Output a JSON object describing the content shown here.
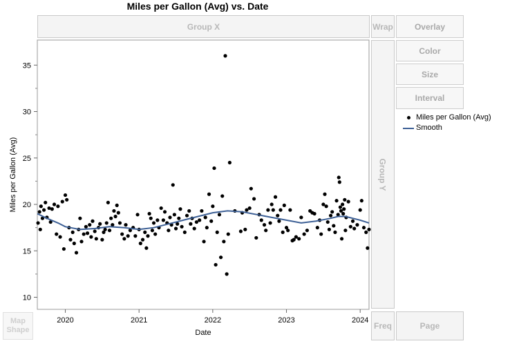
{
  "zones": {
    "group_x": "Group X",
    "group_y": "Group Y",
    "wrap": "Wrap",
    "freq": "Freq",
    "page": "Page",
    "map_shape": "Map Shape"
  },
  "buttons": {
    "overlay": "Overlay",
    "color": "Color",
    "size": "Size",
    "interval": "Interval"
  },
  "chart_data": {
    "type": "scatter",
    "title": "Miles per Gallon (Avg) vs. Date",
    "xlabel": "Date",
    "ylabel": "Miles per Gallon (Avg)",
    "xlim": [
      2019.62,
      2024.12
    ],
    "ylim": [
      8.7,
      37.7
    ],
    "x_ticks": [
      2020,
      2021,
      2022,
      2023,
      2024
    ],
    "y_ticks": [
      10,
      15,
      20,
      25,
      30,
      35
    ],
    "grid": false,
    "legend_position": "right",
    "legend": [
      "Miles per Gallon (Avg)",
      "Smooth"
    ],
    "colors": {
      "points": "#000000",
      "smooth": "#3c5f95"
    },
    "series": [
      {
        "name": "Miles per Gallon (Avg)",
        "kind": "points",
        "points": [
          [
            2019.63,
            18.0
          ],
          [
            2019.65,
            19.2
          ],
          [
            2019.66,
            17.3
          ],
          [
            2019.67,
            19.8
          ],
          [
            2019.69,
            18.5
          ],
          [
            2019.71,
            19.4
          ],
          [
            2019.73,
            20.2
          ],
          [
            2019.75,
            18.6
          ],
          [
            2019.78,
            19.6
          ],
          [
            2019.8,
            18.1
          ],
          [
            2019.82,
            19.5
          ],
          [
            2019.85,
            20.0
          ],
          [
            2019.88,
            16.8
          ],
          [
            2019.9,
            19.8
          ],
          [
            2019.93,
            16.5
          ],
          [
            2019.96,
            20.3
          ],
          [
            2019.98,
            15.2
          ],
          [
            2020.0,
            21.0
          ],
          [
            2020.02,
            20.5
          ],
          [
            2020.05,
            17.5
          ],
          [
            2020.07,
            16.2
          ],
          [
            2020.1,
            17.0
          ],
          [
            2020.12,
            15.8
          ],
          [
            2020.15,
            14.8
          ],
          [
            2020.18,
            17.3
          ],
          [
            2020.2,
            18.5
          ],
          [
            2020.22,
            16.0
          ],
          [
            2020.25,
            16.8
          ],
          [
            2020.28,
            17.6
          ],
          [
            2020.3,
            16.9
          ],
          [
            2020.33,
            17.8
          ],
          [
            2020.35,
            16.5
          ],
          [
            2020.37,
            18.2
          ],
          [
            2020.4,
            17.1
          ],
          [
            2020.42,
            16.3
          ],
          [
            2020.45,
            17.5
          ],
          [
            2020.47,
            17.9
          ],
          [
            2020.5,
            16.2
          ],
          [
            2020.52,
            17.0
          ],
          [
            2020.54,
            17.3
          ],
          [
            2020.56,
            18.0
          ],
          [
            2020.58,
            20.2
          ],
          [
            2020.6,
            17.2
          ],
          [
            2020.62,
            18.5
          ],
          [
            2020.64,
            17.8
          ],
          [
            2020.66,
            19.3
          ],
          [
            2020.68,
            18.7
          ],
          [
            2020.7,
            19.9
          ],
          [
            2020.72,
            19.1
          ],
          [
            2020.74,
            18.0
          ],
          [
            2020.77,
            16.8
          ],
          [
            2020.8,
            16.3
          ],
          [
            2020.82,
            17.8
          ],
          [
            2020.85,
            16.6
          ],
          [
            2020.88,
            17.2
          ],
          [
            2020.92,
            17.5
          ],
          [
            2020.95,
            16.6
          ],
          [
            2020.98,
            18.9
          ],
          [
            2021.0,
            17.3
          ],
          [
            2021.02,
            15.8
          ],
          [
            2021.05,
            16.2
          ],
          [
            2021.08,
            17.0
          ],
          [
            2021.1,
            15.3
          ],
          [
            2021.12,
            16.6
          ],
          [
            2021.14,
            19.0
          ],
          [
            2021.16,
            18.5
          ],
          [
            2021.18,
            17.2
          ],
          [
            2021.2,
            18.0
          ],
          [
            2021.22,
            16.8
          ],
          [
            2021.25,
            18.3
          ],
          [
            2021.27,
            17.5
          ],
          [
            2021.3,
            19.6
          ],
          [
            2021.33,
            18.3
          ],
          [
            2021.35,
            19.2
          ],
          [
            2021.38,
            18.0
          ],
          [
            2021.4,
            17.2
          ],
          [
            2021.42,
            18.6
          ],
          [
            2021.44,
            17.8
          ],
          [
            2021.46,
            22.1
          ],
          [
            2021.48,
            18.9
          ],
          [
            2021.5,
            17.4
          ],
          [
            2021.52,
            17.9
          ],
          [
            2021.54,
            18.5
          ],
          [
            2021.56,
            19.5
          ],
          [
            2021.58,
            17.6
          ],
          [
            2021.62,
            17.0
          ],
          [
            2021.65,
            18.8
          ],
          [
            2021.68,
            19.3
          ],
          [
            2021.7,
            17.9
          ],
          [
            2021.72,
            18.5
          ],
          [
            2021.75,
            17.4
          ],
          [
            2021.78,
            18.1
          ],
          [
            2021.82,
            18.3
          ],
          [
            2021.85,
            19.3
          ],
          [
            2021.88,
            16.0
          ],
          [
            2021.9,
            18.6
          ],
          [
            2021.92,
            17.5
          ],
          [
            2021.95,
            21.1
          ],
          [
            2021.98,
            18.2
          ],
          [
            2022.0,
            19.8
          ],
          [
            2022.02,
            23.9
          ],
          [
            2022.04,
            13.5
          ],
          [
            2022.06,
            17.0
          ],
          [
            2022.09,
            18.9
          ],
          [
            2022.11,
            14.3
          ],
          [
            2022.13,
            20.9
          ],
          [
            2022.15,
            16.0
          ],
          [
            2022.17,
            36.0
          ],
          [
            2022.19,
            12.5
          ],
          [
            2022.21,
            16.8
          ],
          [
            2022.23,
            24.5
          ],
          [
            2022.3,
            19.3
          ],
          [
            2022.38,
            17.1
          ],
          [
            2022.4,
            19.1
          ],
          [
            2022.44,
            17.3
          ],
          [
            2022.46,
            19.4
          ],
          [
            2022.5,
            19.6
          ],
          [
            2022.52,
            21.7
          ],
          [
            2022.56,
            20.6
          ],
          [
            2022.59,
            16.4
          ],
          [
            2022.63,
            18.9
          ],
          [
            2022.66,
            18.3
          ],
          [
            2022.7,
            17.8
          ],
          [
            2022.72,
            17.2
          ],
          [
            2022.75,
            19.4
          ],
          [
            2022.78,
            18.0
          ],
          [
            2022.8,
            20.0
          ],
          [
            2022.82,
            19.4
          ],
          [
            2022.85,
            20.8
          ],
          [
            2022.88,
            18.8
          ],
          [
            2022.9,
            18.2
          ],
          [
            2022.92,
            19.4
          ],
          [
            2022.95,
            17.0
          ],
          [
            2022.97,
            19.9
          ],
          [
            2023.0,
            17.5
          ],
          [
            2023.02,
            17.2
          ],
          [
            2023.05,
            19.4
          ],
          [
            2023.08,
            16.1
          ],
          [
            2023.1,
            16.2
          ],
          [
            2023.13,
            16.5
          ],
          [
            2023.17,
            16.3
          ],
          [
            2023.2,
            18.6
          ],
          [
            2023.24,
            16.8
          ],
          [
            2023.28,
            17.2
          ],
          [
            2023.32,
            19.3
          ],
          [
            2023.35,
            19.1
          ],
          [
            2023.38,
            19.0
          ],
          [
            2023.42,
            17.5
          ],
          [
            2023.45,
            18.3
          ],
          [
            2023.47,
            16.8
          ],
          [
            2023.5,
            20.0
          ],
          [
            2023.52,
            21.1
          ],
          [
            2023.54,
            19.8
          ],
          [
            2023.56,
            18.1
          ],
          [
            2023.58,
            17.3
          ],
          [
            2023.6,
            18.8
          ],
          [
            2023.62,
            19.2
          ],
          [
            2023.64,
            17.7
          ],
          [
            2023.66,
            17.0
          ],
          [
            2023.68,
            20.4
          ],
          [
            2023.7,
            18.9
          ],
          [
            2023.71,
            22.9
          ],
          [
            2023.72,
            22.4
          ],
          [
            2023.73,
            19.7
          ],
          [
            2023.74,
            19.3
          ],
          [
            2023.75,
            16.3
          ],
          [
            2023.76,
            20.0
          ],
          [
            2023.77,
            19.0
          ],
          [
            2023.78,
            19.5
          ],
          [
            2023.79,
            20.5
          ],
          [
            2023.8,
            17.2
          ],
          [
            2023.81,
            18.6
          ],
          [
            2023.84,
            20.3
          ],
          [
            2023.87,
            17.6
          ],
          [
            2023.9,
            18.2
          ],
          [
            2023.92,
            17.4
          ],
          [
            2023.96,
            17.8
          ],
          [
            2024.0,
            19.4
          ],
          [
            2024.02,
            20.4
          ],
          [
            2024.05,
            17.5
          ],
          [
            2024.08,
            17.0
          ],
          [
            2024.1,
            15.3
          ],
          [
            2024.12,
            17.3
          ]
        ]
      },
      {
        "name": "Smooth",
        "kind": "line",
        "points": [
          [
            2019.62,
            19.0
          ],
          [
            2019.75,
            18.5
          ],
          [
            2019.9,
            18.0
          ],
          [
            2020.0,
            17.6
          ],
          [
            2020.2,
            17.3
          ],
          [
            2020.4,
            17.4
          ],
          [
            2020.6,
            17.6
          ],
          [
            2020.8,
            17.5
          ],
          [
            2021.0,
            17.3
          ],
          [
            2021.2,
            17.5
          ],
          [
            2021.4,
            17.9
          ],
          [
            2021.6,
            18.3
          ],
          [
            2021.8,
            18.7
          ],
          [
            2022.0,
            19.1
          ],
          [
            2022.2,
            19.3
          ],
          [
            2022.4,
            19.2
          ],
          [
            2022.6,
            18.9
          ],
          [
            2022.8,
            18.6
          ],
          [
            2023.0,
            18.3
          ],
          [
            2023.2,
            18.0
          ],
          [
            2023.4,
            18.2
          ],
          [
            2023.6,
            18.5
          ],
          [
            2023.7,
            18.7
          ],
          [
            2023.8,
            18.7
          ],
          [
            2023.9,
            18.5
          ],
          [
            2024.0,
            18.3
          ],
          [
            2024.12,
            18.0
          ]
        ]
      }
    ]
  }
}
